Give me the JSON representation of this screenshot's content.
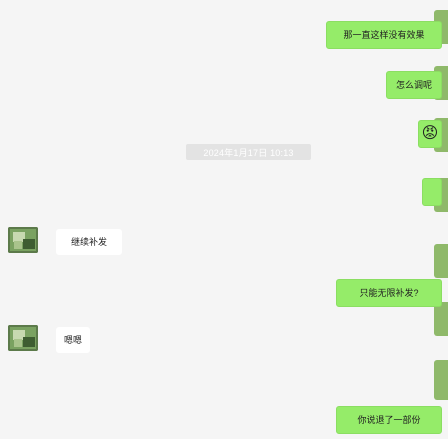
{
  "chat": {
    "messages_right": [
      {
        "text": "那一直这样没有效果"
      },
      {
        "text": "怎么调呢"
      },
      {
        "emoji": "😡"
      },
      {
        "text": "只能无限补发?"
      },
      {
        "text": "你说退了一部份"
      }
    ],
    "timestamp": "2024年1月17日 10:13",
    "messages_left": [
      {
        "text": "继续补发"
      },
      {
        "text": "嗯嗯"
      }
    ]
  },
  "colors": {
    "background": "#f5f5f5",
    "bubble_self": "#95ec69",
    "bubble_other": "#ffffff",
    "timestamp_bg": "#e3e3e3"
  },
  "icons": {
    "avatar_other": "avatar-icon",
    "avatar_self": "avatar-icon"
  }
}
